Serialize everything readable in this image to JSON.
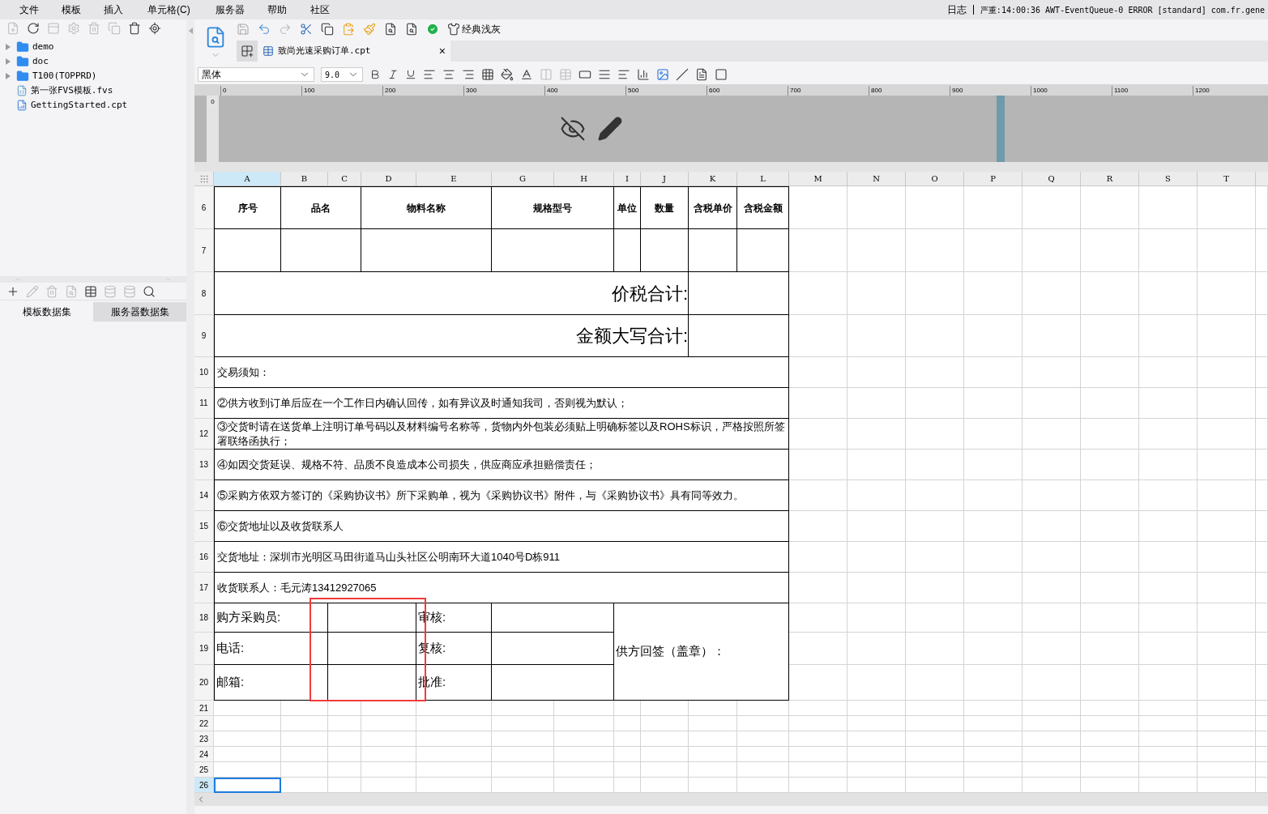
{
  "menu": [
    "文件",
    "模板",
    "插入",
    "单元格(C)",
    "服务器",
    "帮助",
    "社区"
  ],
  "log": {
    "label": "日志",
    "message": "严重:14:00:36 AWT-EventQueue-0 ERROR [standard] com.fr.gene"
  },
  "file_tree": [
    {
      "label": "demo",
      "kind": "folder"
    },
    {
      "label": "doc",
      "kind": "folder"
    },
    {
      "label": "T100(TOPPRD)",
      "kind": "folder"
    },
    {
      "label": "第一张FVS模板.fvs",
      "kind": "fvs"
    },
    {
      "label": "GettingStarted.cpt",
      "kind": "cpt"
    }
  ],
  "dataset_tabs": [
    {
      "label": "模板数据集",
      "selected": true
    },
    {
      "label": "服务器数据集",
      "selected": false
    }
  ],
  "theme_button": "经典浅灰",
  "document_tab": {
    "title": "致尚光速采购订单.cpt",
    "close": "×"
  },
  "format_bar": {
    "font": "黑体",
    "size": "9.0"
  },
  "vertical_ruler": "0",
  "ruler": [
    "0",
    "100",
    "200",
    "300",
    "400",
    "500",
    "600",
    "700",
    "800",
    "900",
    "1000",
    "1100",
    "1200"
  ],
  "sheet": {
    "columns": [
      {
        "label": "A",
        "selected": true
      },
      {
        "label": "B",
        "selected": false
      },
      {
        "label": "C",
        "selected": false
      },
      {
        "label": "D",
        "selected": false
      },
      {
        "label": "E",
        "selected": false
      },
      {
        "label": "G",
        "selected": false
      },
      {
        "label": "H",
        "selected": false
      },
      {
        "label": "I",
        "selected": false
      },
      {
        "label": "J",
        "selected": false
      },
      {
        "label": "K",
        "selected": false
      },
      {
        "label": "L",
        "selected": false
      },
      {
        "label": "M",
        "selected": false
      },
      {
        "label": "N",
        "selected": false
      },
      {
        "label": "O",
        "selected": false
      },
      {
        "label": "P",
        "selected": false
      },
      {
        "label": "Q",
        "selected": false
      },
      {
        "label": "R",
        "selected": false
      },
      {
        "label": "S",
        "selected": false
      },
      {
        "label": "T",
        "selected": false
      }
    ],
    "rows": [
      {
        "label": "6",
        "selected": false
      },
      {
        "label": "7",
        "selected": false
      },
      {
        "label": "8",
        "selected": false
      },
      {
        "label": "9",
        "selected": false
      },
      {
        "label": "10",
        "selected": false
      },
      {
        "label": "11",
        "selected": false
      },
      {
        "label": "12",
        "selected": false
      },
      {
        "label": "13",
        "selected": false
      },
      {
        "label": "14",
        "selected": false
      },
      {
        "label": "15",
        "selected": false
      },
      {
        "label": "16",
        "selected": false
      },
      {
        "label": "17",
        "selected": false
      },
      {
        "label": "18",
        "selected": false
      },
      {
        "label": "19",
        "selected": false
      },
      {
        "label": "20",
        "selected": false
      },
      {
        "label": "21",
        "selected": false
      },
      {
        "label": "22",
        "selected": false
      },
      {
        "label": "23",
        "selected": false
      },
      {
        "label": "24",
        "selected": false
      },
      {
        "label": "25",
        "selected": false
      },
      {
        "label": "26",
        "selected": true
      }
    ],
    "header": [
      "序号",
      "品名",
      "物料名称",
      "规格型号",
      "单位",
      "数量",
      "含税单价",
      "含税金额"
    ],
    "totals": [
      "价税合计:",
      "金额大写合计:"
    ],
    "notes": [
      "交易须知：",
      "②供方收到订单后应在一个工作日内确认回传，如有异议及时通知我司，否则视为默认；",
      "③交货时请在送货单上注明订单号码以及材料编号名称等，货物内外包装必须贴上明确标签以及ROHS标识，严格按照所签署联络函执行；",
      "④如因交货延误、规格不符、品质不良造成本公司损失，供应商应承担赔偿责任；",
      "⑤采购方依双方签订的《采购协议书》所下采购单，视为《采购协议书》附件，与《采购协议书》具有同等效力。",
      "⑥交货地址以及收货联系人",
      "交货地址：深圳市光明区马田街道马山头社区公明南环大道1040号D栋911",
      "收货联系人：毛元涛13412927065"
    ],
    "signoff": {
      "left": [
        "购方采购员:",
        "电话:",
        "邮箱:"
      ],
      "middle": [
        "审核:",
        "复核:",
        "批准:"
      ],
      "supplier": "供方回签（盖章）："
    }
  }
}
